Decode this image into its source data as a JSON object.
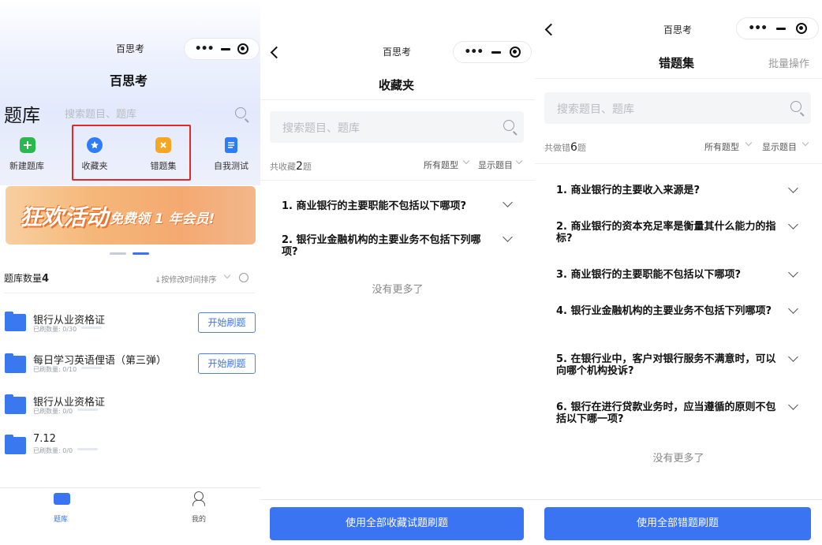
{
  "screen1": {
    "window_title": "百思考",
    "app_title": "百思考",
    "section_title": "题库",
    "search_placeholder": "搜索题目、题库",
    "shortcuts": [
      {
        "label": "新建题库",
        "icon": "plus-icon",
        "color": "#2bb84e"
      },
      {
        "label": "收藏夹",
        "icon": "star-icon",
        "color": "#2e7cf6"
      },
      {
        "label": "错题集",
        "icon": "x-icon",
        "color": "#f5a623"
      },
      {
        "label": "自我测试",
        "icon": "list-icon",
        "color": "#2e7cf6"
      }
    ],
    "banner": {
      "text_main": "狂欢活动",
      "text_sub": "免费领 1 年会员!"
    },
    "count_label": "题库数量",
    "count_value": "4",
    "sort_label": "↓按修改时间排序",
    "books": [
      {
        "title": "银行从业资格证",
        "sub": "已刷数量: 0/30",
        "button": "开始刷题"
      },
      {
        "title": "每日学习英语俚语（第三弹）",
        "sub": "已刷数量: 0/10",
        "button": "开始刷题"
      },
      {
        "title": "银行从业资格证",
        "sub": "已刷数量: 0/0"
      },
      {
        "title": "7.12",
        "sub": "已刷数量: 0/0"
      }
    ],
    "tabbar": [
      {
        "label": "题库",
        "icon": "folder-icon",
        "active": true
      },
      {
        "label": "我的",
        "icon": "user-icon",
        "active": false
      }
    ]
  },
  "screen2": {
    "window_title": "百思考",
    "page_title": "收藏夹",
    "search_placeholder": "搜索题目、题库",
    "count_prefix": "共收藏",
    "count_value": "2",
    "count_suffix": "题",
    "filter_type": "所有题型",
    "filter_show": "显示题目",
    "questions": [
      "1. 商业银行的主要职能不包括以下哪项?",
      "2. 银行业金融机构的主要业务不包括下列哪项?"
    ],
    "no_more": "没有更多了",
    "bottom_button": "使用全部收藏试题刷题"
  },
  "screen3": {
    "window_title": "百思考",
    "page_title": "错题集",
    "batch_action": "批量操作",
    "search_placeholder": "搜索题目、题库",
    "count_prefix": "共做错",
    "count_value": "6",
    "count_suffix": "题",
    "filter_type": "所有题型",
    "filter_show": "显示题目",
    "questions": [
      "1. 商业银行的主要收入来源是?",
      "2. 商业银行的资本充足率是衡量其什么能力的指标?",
      "3. 商业银行的主要职能不包括以下哪项?",
      "4. 银行业金融机构的主要业务不包括下列哪项?",
      "5. 在银行业中，客户对银行服务不满意时，可以向哪个机构投诉?",
      "6. 银行在进行贷款业务时，应当遵循的原则不包括以下哪一项?"
    ],
    "no_more": "没有更多了",
    "bottom_button": "使用全部错题刷题"
  }
}
